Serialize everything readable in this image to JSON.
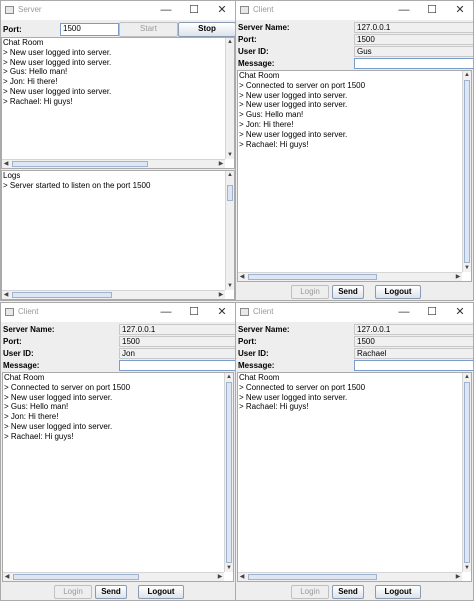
{
  "server": {
    "title": "Server",
    "port_label": "Port:",
    "port_value": "1500",
    "start_label": "Start",
    "stop_label": "Stop",
    "chat_lines": [
      "Chat Room",
      "> New user logged into server.",
      "> New user logged into server.",
      "> Gus: Hello man!",
      "> Jon: Hi there!",
      "> New user logged into server.",
      "> Rachael: Hi guys!"
    ],
    "log_lines": [
      "Logs",
      "> Server started to listen on the port 1500"
    ]
  },
  "clients": [
    {
      "title": "Client",
      "server_name_label": "Server Name:",
      "server_name": "127.0.0.1",
      "port_label": "Port:",
      "port": "1500",
      "user_id_label": "User ID:",
      "user_id": "Gus",
      "message_label": "Message:",
      "message": "",
      "chat_lines": [
        "Chat Room",
        "> Connected to server on port 1500",
        "> New user logged into server.",
        "> New user logged into server.",
        "> Gus: Hello man!",
        "> Jon: Hi there!",
        "> New user logged into server.",
        "> Rachael: Hi guys!"
      ],
      "login_label": "Login",
      "send_label": "Send",
      "logout_label": "Logout"
    },
    {
      "title": "Client",
      "server_name_label": "Server Name:",
      "server_name": "127.0.0.1",
      "port_label": "Port:",
      "port": "1500",
      "user_id_label": "User ID:",
      "user_id": "Jon",
      "message_label": "Message:",
      "message": "",
      "chat_lines": [
        "Chat Room",
        "> Connected to server on port 1500",
        "> New user logged into server.",
        "> Gus: Hello man!",
        "> Jon: Hi there!",
        "> New user logged into server.",
        "> Rachael: Hi guys!"
      ],
      "login_label": "Login",
      "send_label": "Send",
      "logout_label": "Logout"
    },
    {
      "title": "Client",
      "server_name_label": "Server Name:",
      "server_name": "127.0.0.1",
      "port_label": "Port:",
      "port": "1500",
      "user_id_label": "User ID:",
      "user_id": "Rachael",
      "message_label": "Message:",
      "message": "",
      "chat_lines": [
        "Chat Room",
        "> Connected to server on port 1500",
        "> New user logged into server.",
        "> Rachael: Hi guys!"
      ],
      "login_label": "Login",
      "send_label": "Send",
      "logout_label": "Logout"
    }
  ],
  "window_controls": {
    "minimize": "—",
    "maximize": "☐",
    "close": "✕"
  }
}
